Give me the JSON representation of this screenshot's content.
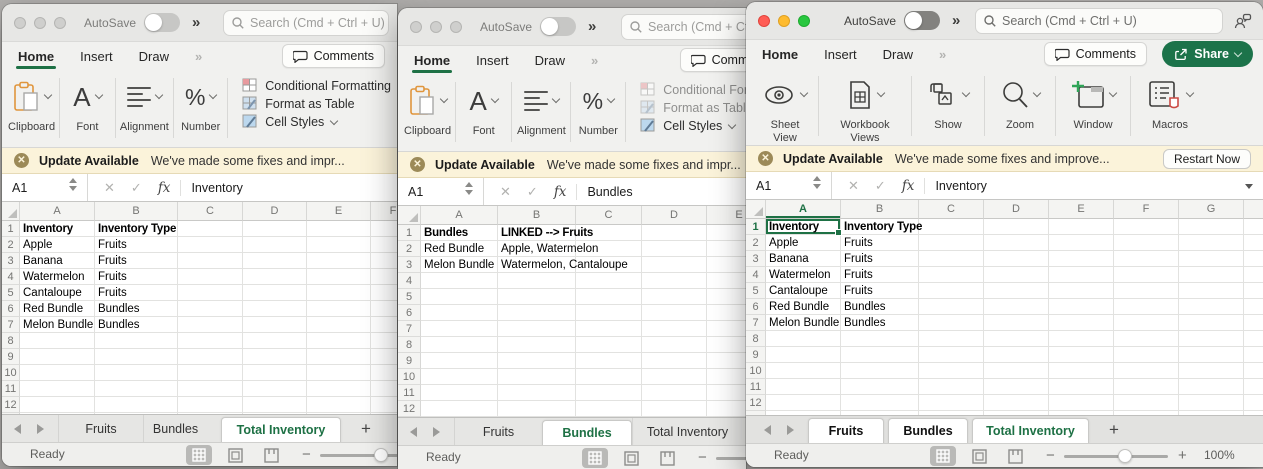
{
  "colors": {
    "accent_green": "#1e7145",
    "banner_bg": "#fbf3da",
    "share_green": "#1c734a"
  },
  "windows": [
    {
      "titlebar": {
        "autosave": "AutoSave",
        "more": "»",
        "search": "Search (Cmd + Ctrl + U)"
      },
      "menu": {
        "tabs": [
          "Home",
          "Insert",
          "Draw"
        ],
        "more": "»",
        "comments": "Comments"
      },
      "ribbon": {
        "groups": [
          "Clipboard",
          "Font",
          "Alignment",
          "Number"
        ],
        "styles": [
          "Conditional Formatting",
          "Format as Table",
          "Cell Styles"
        ]
      },
      "banner": {
        "title": "Update Available",
        "message": "We've made some fixes and impr..."
      },
      "formula": {
        "name_box": "A1",
        "fx": "fx",
        "value": "Inventory"
      },
      "grid": {
        "columns": [
          "A",
          "B",
          "C",
          "D",
          "E",
          "F"
        ],
        "rows": [
          {
            "n": "1",
            "bold": true,
            "cells": {
              "A": "Inventory",
              "B": "Inventory Type"
            }
          },
          {
            "n": "2",
            "cells": {
              "A": "Apple",
              "B": "Fruits"
            }
          },
          {
            "n": "3",
            "cells": {
              "A": "Banana",
              "B": "Fruits"
            }
          },
          {
            "n": "4",
            "cells": {
              "A": "Watermelon",
              "B": "Fruits"
            }
          },
          {
            "n": "5",
            "cells": {
              "A": "Cantaloupe",
              "B": "Fruits"
            }
          },
          {
            "n": "6",
            "cells": {
              "A": "Red Bundle",
              "B": "Bundles"
            }
          },
          {
            "n": "7",
            "cells": {
              "A": "Melon Bundle",
              "B": "Bundles"
            }
          },
          {
            "n": "8"
          },
          {
            "n": "9"
          },
          {
            "n": "10"
          },
          {
            "n": "11"
          },
          {
            "n": "12"
          }
        ]
      },
      "sheets": {
        "tabs": [
          {
            "label": "Fruits"
          },
          {
            "label": "Bundles"
          },
          {
            "label": "Total Inventory",
            "active": true
          }
        ],
        "add": "+"
      },
      "status": {
        "ready": "Ready"
      }
    },
    {
      "titlebar": {
        "autosave": "AutoSave",
        "more": "»",
        "search": "Search (Cmd + Ctrl + U)"
      },
      "menu": {
        "tabs": [
          "Home",
          "Insert",
          "Draw"
        ],
        "more": "»",
        "comments": "Comments"
      },
      "ribbon": {
        "groups": [
          "Clipboard",
          "Font",
          "Alignment",
          "Number"
        ],
        "styles": [
          "Conditional Formatting",
          "Format as Table",
          "Cell Styles"
        ]
      },
      "banner": {
        "title": "Update Available",
        "message": "We've made some fixes and impr..."
      },
      "formula": {
        "name_box": "A1",
        "fx": "fx",
        "value": "Bundles"
      },
      "grid": {
        "columns": [
          "A",
          "B",
          "C",
          "D",
          "E"
        ],
        "rows": [
          {
            "n": "1",
            "bold": true,
            "cells": {
              "A": "Bundles",
              "B": "LINKED --> Fruits"
            }
          },
          {
            "n": "2",
            "cells": {
              "A": "Red Bundle",
              "B": "Apple, Watermelon"
            }
          },
          {
            "n": "3",
            "cells": {
              "A": "Melon Bundle",
              "B": "Watermelon, Cantaloupe"
            }
          },
          {
            "n": "4"
          },
          {
            "n": "5"
          },
          {
            "n": "6"
          },
          {
            "n": "7"
          },
          {
            "n": "8"
          },
          {
            "n": "9"
          },
          {
            "n": "10"
          },
          {
            "n": "11"
          },
          {
            "n": "12"
          }
        ]
      },
      "sheets": {
        "tabs": [
          {
            "label": "Fruits"
          },
          {
            "label": "Bundles",
            "active": true
          },
          {
            "label": "Total Inventory"
          }
        ],
        "add": "+"
      },
      "status": {
        "ready": "Ready"
      }
    },
    {
      "titlebar": {
        "autosave": "AutoSave",
        "more": "»",
        "search": "Search (Cmd + Ctrl + U)"
      },
      "menu": {
        "tabs": [
          "Home",
          "Insert",
          "Draw"
        ],
        "more": "»",
        "comments": "Comments",
        "share": "Share"
      },
      "ribbon": {
        "groups": [
          "Sheet\nView",
          "Workbook\nViews",
          "Show",
          "Zoom",
          "Window",
          "Macros"
        ]
      },
      "banner": {
        "title": "Update Available",
        "message": "We've made some fixes and improve...",
        "action": "Restart Now"
      },
      "formula": {
        "name_box": "A1",
        "fx": "fx",
        "value": "Inventory"
      },
      "grid": {
        "columns": [
          "A",
          "B",
          "C",
          "D",
          "E",
          "F",
          "G"
        ],
        "selected_cell": "A1",
        "selected_col": "A",
        "selected_row": "1",
        "rows": [
          {
            "n": "1",
            "bold": true,
            "cells": {
              "A": "Inventory",
              "B": "Inventory Type"
            }
          },
          {
            "n": "2",
            "cells": {
              "A": "Apple",
              "B": "Fruits"
            }
          },
          {
            "n": "3",
            "cells": {
              "A": "Banana",
              "B": "Fruits"
            }
          },
          {
            "n": "4",
            "cells": {
              "A": "Watermelon",
              "B": "Fruits"
            }
          },
          {
            "n": "5",
            "cells": {
              "A": "Cantaloupe",
              "B": "Fruits"
            }
          },
          {
            "n": "6",
            "cells": {
              "A": "Red Bundle",
              "B": "Bundles"
            }
          },
          {
            "n": "7",
            "cells": {
              "A": "Melon Bundle",
              "B": "Bundles"
            }
          },
          {
            "n": "8"
          },
          {
            "n": "9"
          },
          {
            "n": "10"
          },
          {
            "n": "11"
          },
          {
            "n": "12"
          }
        ]
      },
      "sheets": {
        "tabs": [
          {
            "label": "Fruits"
          },
          {
            "label": "Bundles"
          },
          {
            "label": "Total Inventory",
            "active": true
          }
        ],
        "add": "+"
      },
      "status": {
        "ready": "Ready",
        "zoom": "100%"
      }
    }
  ]
}
